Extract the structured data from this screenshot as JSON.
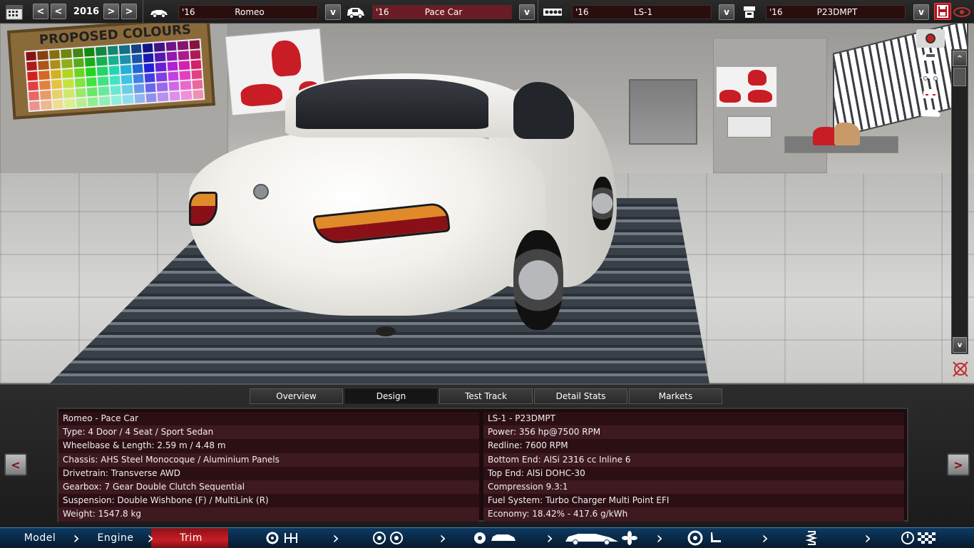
{
  "topbar": {
    "year": "2016",
    "prev_label": "<",
    "next_label": ">",
    "dropdown_label": "v",
    "fields": [
      {
        "year": "'16",
        "name": "Romeo"
      },
      {
        "year": "'16",
        "name": "Pace Car"
      },
      {
        "year": "'16",
        "name": "LS-1"
      },
      {
        "year": "'16",
        "name": "P23DMPT"
      }
    ]
  },
  "viewport": {
    "board_title": "PROPOSED COLOURS",
    "scroll_up": "^",
    "scroll_down": "v"
  },
  "tabs": [
    {
      "label": "Overview"
    },
    {
      "label": "Design"
    },
    {
      "label": "Test Track"
    },
    {
      "label": "Detail Stats"
    },
    {
      "label": "Markets"
    }
  ],
  "panel": {
    "prev_label": "<",
    "next_label": ">",
    "left": [
      "Romeo - Pace Car",
      "Type: 4 Door / 4 Seat / Sport Sedan",
      "Wheelbase & Length: 2.59 m / 4.48 m",
      "Chassis: AHS Steel Monocoque / Aluminium Panels",
      "Drivetrain: Transverse AWD",
      "Gearbox: 7 Gear Double Clutch Sequential",
      "Suspension: Double Wishbone (F) / MultiLink (R)",
      "Weight: 1547.8 kg"
    ],
    "right": [
      "LS-1 - P23DMPT",
      "Power: 356 hp@7500 RPM",
      "Redline: 7600 RPM",
      "Bottom End: AlSi 2316 cc Inline 6",
      "Top End: AlSi DOHC-30",
      "Compression 9.3:1",
      "Fuel System: Turbo Charger Multi Point EFI",
      "Economy: 18.42% - 417.6 g/kWh"
    ]
  },
  "bottombar": {
    "model": "Model",
    "engine": "Engine",
    "trim": "Trim"
  },
  "colors": {
    "accent_red": "#c81d25",
    "selected_field": "#6b1c24",
    "nav_blue": "#0d3a62"
  }
}
